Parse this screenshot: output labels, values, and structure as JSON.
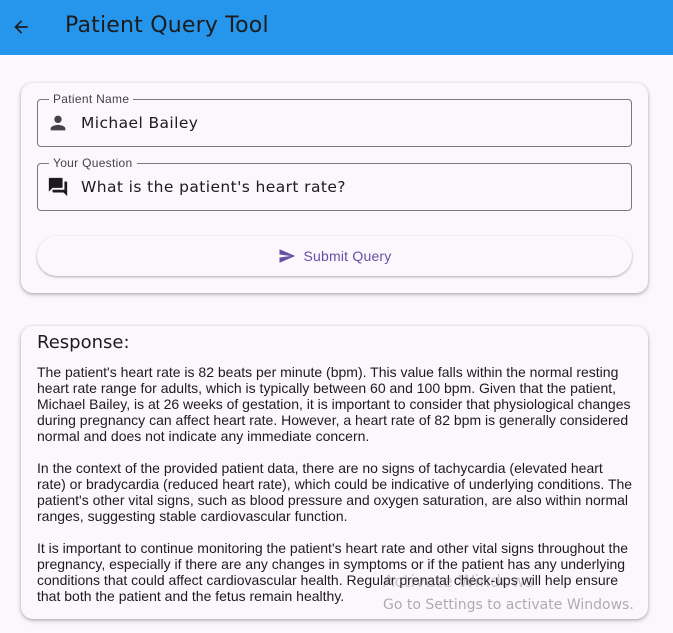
{
  "appbar": {
    "title": "Patient Query Tool",
    "back_icon": "arrow-back-icon",
    "color": "#2596ec"
  },
  "form": {
    "patient_name": {
      "label": "Patient Name",
      "value": "Michael Bailey",
      "icon": "person-icon"
    },
    "question": {
      "label": "Your Question",
      "value": "What is the patient's heart rate?",
      "icon": "question-answer-icon"
    },
    "submit": {
      "label": "Submit Query",
      "icon": "send-icon"
    }
  },
  "response": {
    "title": "Response:",
    "paragraphs": [
      "The patient's heart rate is 82 beats per minute (bpm). This value falls within the normal resting heart rate range for adults, which is typically between 60 and 100 bpm. Given that the patient, Michael Bailey, is at 26 weeks of gestation, it is important to consider that physiological changes during pregnancy can affect heart rate. However, a heart rate of 82 bpm is generally considered normal and does not indicate any immediate concern.",
      "In the context of the provided patient data, there are no signs of tachycardia (elevated heart rate) or bradycardia (reduced heart rate), which could be indicative of underlying conditions. The patient's other vital signs, such as blood pressure and oxygen saturation, are also within normal ranges, suggesting stable cardiovascular function.",
      "It is important to continue monitoring the patient's heart rate and other vital signs throughout the pregnancy, especially if there are any changes in symptoms or if the patient has any underlying conditions that could affect cardiovascular health. Regular prenatal check-ups will help ensure that both the patient and the fetus remain healthy."
    ]
  },
  "watermark": {
    "title": "Activate Windows",
    "subtitle": "Go to Settings to activate Windows."
  }
}
